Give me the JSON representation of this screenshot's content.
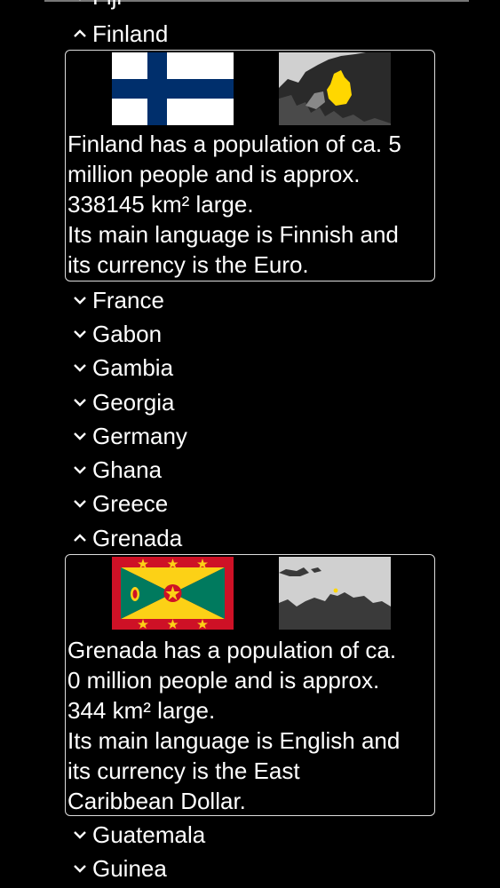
{
  "top_partial_item": "Fiji",
  "items": [
    {
      "name": "Finland",
      "expanded": true
    },
    {
      "name": "France",
      "expanded": false
    },
    {
      "name": "Gabon",
      "expanded": false
    },
    {
      "name": "Gambia",
      "expanded": false
    },
    {
      "name": "Georgia",
      "expanded": false
    },
    {
      "name": "Germany",
      "expanded": false
    },
    {
      "name": "Ghana",
      "expanded": false
    },
    {
      "name": "Greece",
      "expanded": false
    },
    {
      "name": "Grenada",
      "expanded": true
    },
    {
      "name": "Guatemala",
      "expanded": false
    },
    {
      "name": "Guinea",
      "expanded": false
    }
  ],
  "finland": {
    "line1": "Finland has a population of ca. 5",
    "line2": "million people and is approx.",
    "line3": "338145 km² large.",
    "line4": "Its main language is Finnish and",
    "line5": "its currency is the Euro."
  },
  "grenada": {
    "line1": "Grenada has a population of ca.",
    "line2": "0 million people and is approx.",
    "line3": "344 km² large.",
    "line4": "Its main language is English and",
    "line5": "its currency is the East",
    "line6": "Caribbean Dollar."
  },
  "colors": {
    "background": "#000000",
    "text": "#ffffff",
    "finland_blue": "#002f6c",
    "grenada_red": "#ce1126",
    "grenada_yellow": "#fcd116",
    "grenada_green": "#007a5e",
    "map_highlight": "#ffd700",
    "map_land": "#c8c8c8"
  }
}
